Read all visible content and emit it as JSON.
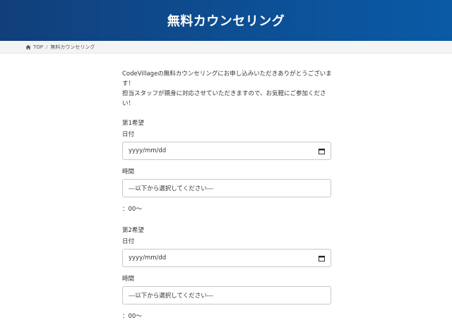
{
  "header": {
    "title": "無料カウンセリング"
  },
  "breadcrumb": {
    "home": "TOP",
    "separator": "/",
    "current": "無料カウンセリング"
  },
  "intro": {
    "line1": "CodeVillageの無料カウンセリングにお申し込みいただきありがとうございます！",
    "line2": "担当スタッフが親身に対応させていただきますので、お気軽にご参加ください！"
  },
  "choices": [
    {
      "title": "第1希望",
      "date_label": "日付",
      "date_placeholder": "yyyy/mm/dd",
      "time_label": "時間",
      "time_value": "---以下から選択してください---",
      "time_suffix": "：00〜"
    },
    {
      "title": "第2希望",
      "date_label": "日付",
      "date_placeholder": "yyyy/mm/dd",
      "time_label": "時間",
      "time_value": "---以下から選択してください---",
      "time_suffix": "：00〜"
    }
  ],
  "colors": {
    "header_start": "#113f7a",
    "header_end": "#0a5aa6"
  },
  "icons": {
    "home": "home-icon",
    "calendar": "calendar-icon"
  }
}
